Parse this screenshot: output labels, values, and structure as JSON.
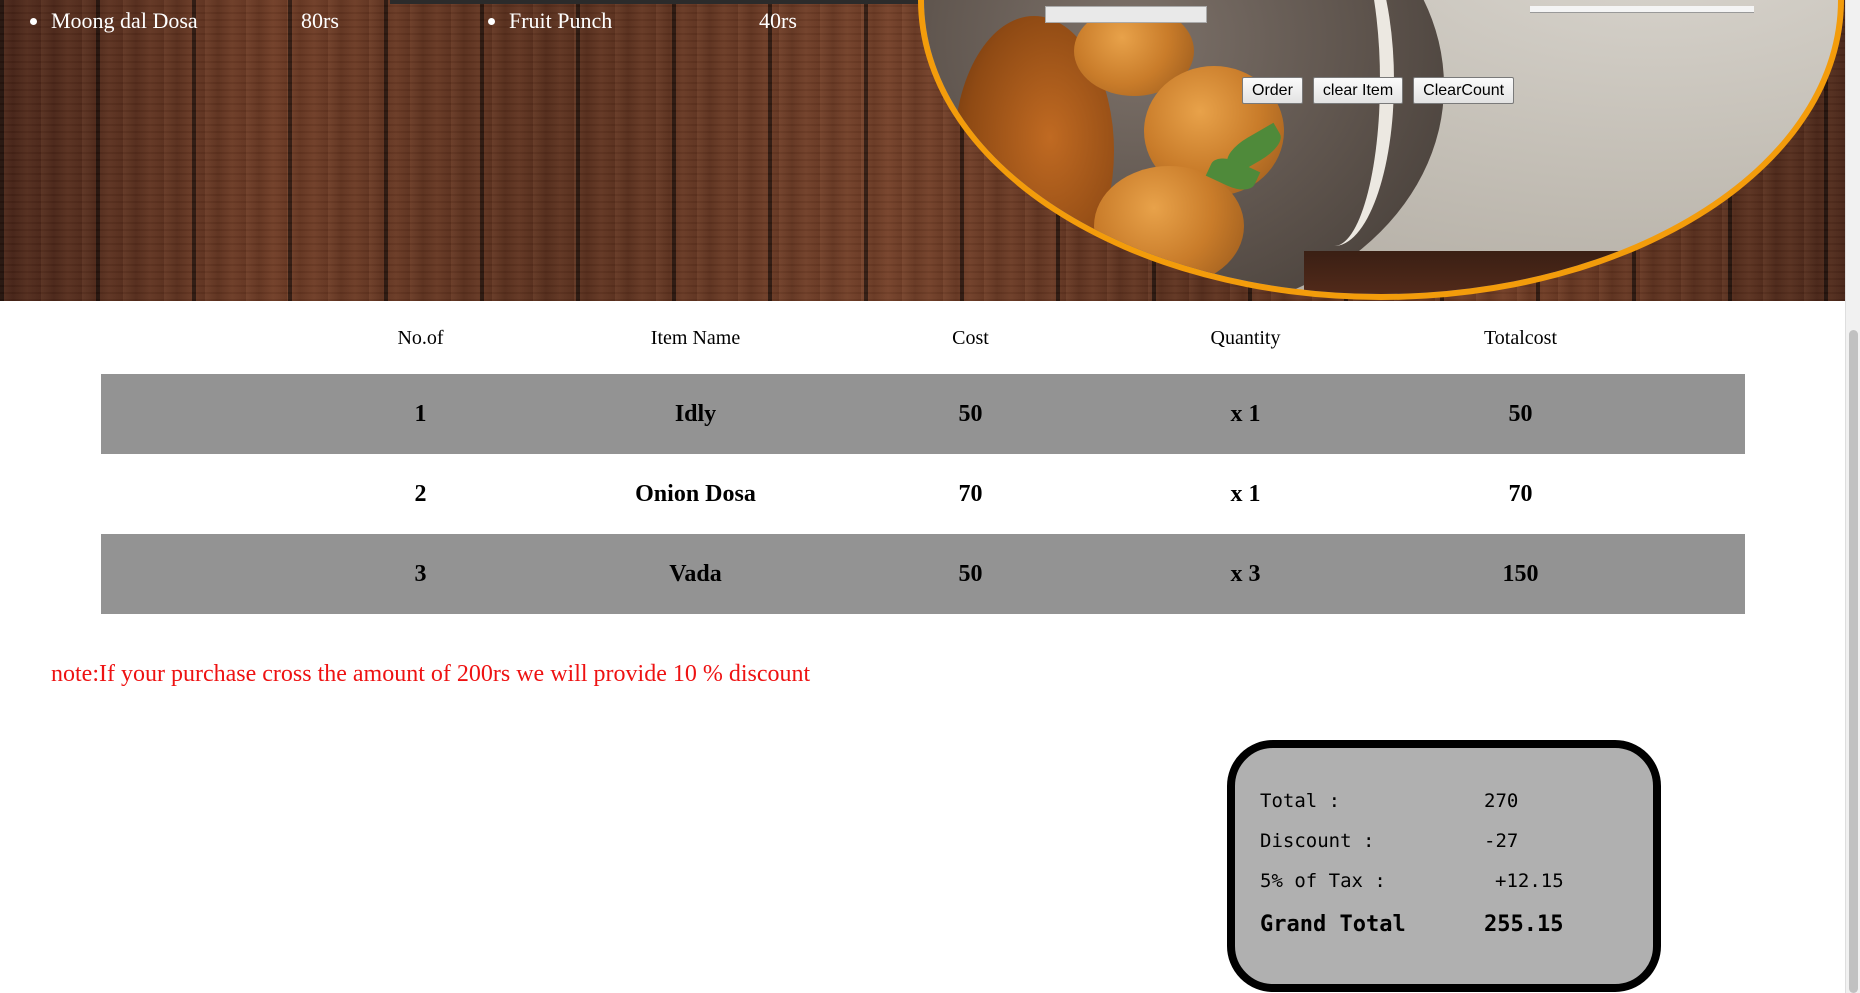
{
  "menu": {
    "left": [
      {
        "name": "Moong dal Dosa",
        "price": "80rs"
      }
    ],
    "right": [
      {
        "name": "Fruit Punch",
        "price": "40rs"
      }
    ]
  },
  "actions": {
    "order_label": "Order",
    "clear_item_label": "clear Item",
    "clear_count_label": "ClearCount"
  },
  "table": {
    "headers": [
      "No.of",
      "Item Name",
      "Cost",
      "Quantity",
      "Totalcost"
    ],
    "rows": [
      {
        "no": "1",
        "item": "Idly",
        "cost": "50",
        "qty": "x 1",
        "total": "50"
      },
      {
        "no": "2",
        "item": "Onion Dosa",
        "cost": "70",
        "qty": "x 1",
        "total": "70"
      },
      {
        "no": "3",
        "item": "Vada",
        "cost": "50",
        "qty": "x 3",
        "total": "150"
      }
    ]
  },
  "note": "note:If your purchase cross the amount of 200rs we will provide 10 % discount",
  "bill": {
    "total_label": "Total :",
    "total_value": "270",
    "discount_label": "Discount :",
    "discount_value": "-27",
    "tax_label": "5% of Tax :",
    "tax_value": "+12.15",
    "grand_label": "Grand Total",
    "grand_value": "255.15"
  },
  "colors": {
    "oval_border": "#f39c0b",
    "note_text": "#ee1212",
    "row_shade": "#939393",
    "bill_background": "#b0b0b0"
  }
}
